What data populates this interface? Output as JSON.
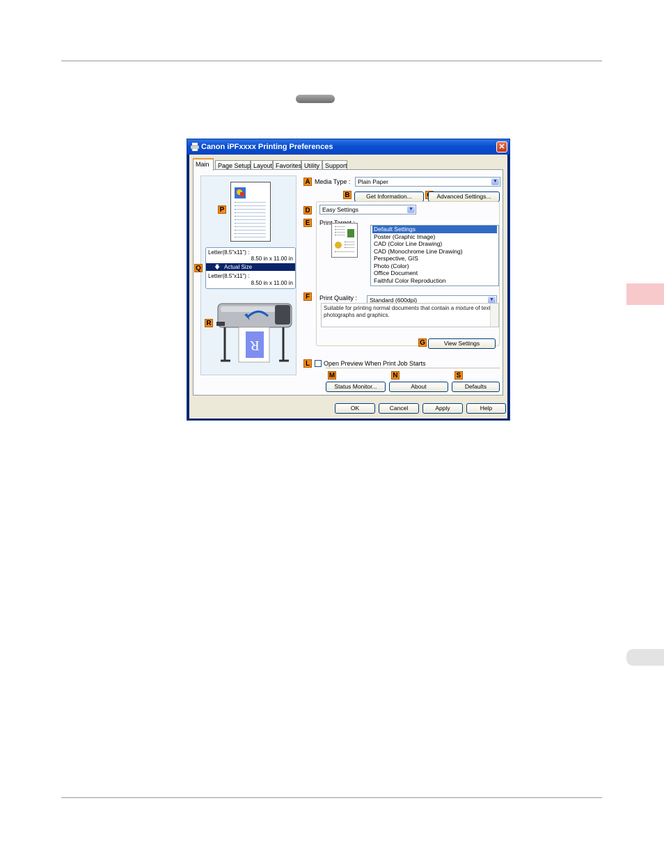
{
  "dialog": {
    "title": "Canon iPFxxxx Printing Preferences",
    "close_label": "✕",
    "tabs": [
      "Main",
      "Page Setup",
      "Layout",
      "Favorites",
      "Utility",
      "Support"
    ],
    "active_tab": "Main"
  },
  "markers": {
    "A": "A",
    "B": "B",
    "C": "C",
    "D": "D",
    "E": "E",
    "F": "F",
    "G": "G",
    "L": "L",
    "M": "M",
    "N": "N",
    "S": "S",
    "P": "P",
    "Q": "Q",
    "R": "R"
  },
  "media": {
    "label": "Media Type :",
    "value": "Plain Paper",
    "get_info_button": "Get Information...",
    "advanced_button": "Advanced Settings..."
  },
  "settings_mode": {
    "value": "Easy Settings"
  },
  "print_target": {
    "label": "Print Target :",
    "items": [
      "Default Settings",
      "Poster (Graphic Image)",
      "CAD (Color Line Drawing)",
      "CAD (Monochrome Line Drawing)",
      "Perspective, GIS",
      "Photo (Color)",
      "Office Document",
      "Faithful Color Reproduction"
    ],
    "selected_index": 0
  },
  "print_quality": {
    "label": "Print Quality :",
    "value": "Standard (600dpi)",
    "description": "Suitable for printing normal documents that contain a mixture of text, photographs and graphics."
  },
  "view_settings_button": "View Settings",
  "open_preview": {
    "label": "Open Preview When Print Job Starts",
    "checked": false
  },
  "bottom_buttons": {
    "status_monitor": "Status Monitor...",
    "about": "About",
    "defaults": "Defaults"
  },
  "dialog_buttons": {
    "ok": "OK",
    "cancel": "Cancel",
    "apply": "Apply",
    "help": "Help"
  },
  "preview": {
    "source_size": "Letter(8.5\"x11\") :",
    "source_dims": "8.50 in x 11.00 in",
    "scaling": "Actual Size",
    "output_size": "Letter(8.5\"x11\") :",
    "output_dims": "8.50 in x 11.00 in"
  },
  "colors": {
    "title_bar": "#0a4fd0",
    "marker_orange": "#f28c1a",
    "selection": "#316ac5",
    "side_tab_pink": "#f8c9cb"
  }
}
